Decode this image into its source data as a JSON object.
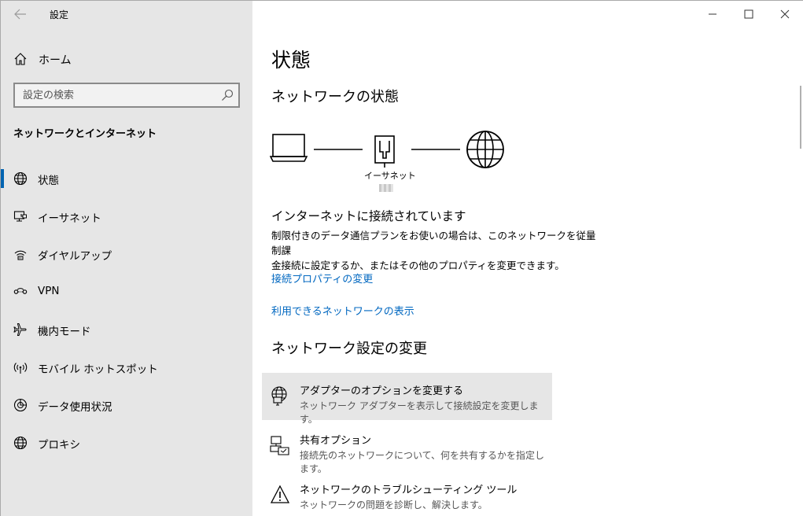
{
  "window": {
    "title": "設定"
  },
  "sidebar": {
    "home_label": "ホーム",
    "search_placeholder": "設定の検索",
    "section_label": "ネットワークとインターネット",
    "items": [
      {
        "label": "状態",
        "icon": "globe-icon",
        "active": true
      },
      {
        "label": "イーサネット",
        "icon": "ethernet-icon",
        "active": false
      },
      {
        "label": "ダイヤルアップ",
        "icon": "dialup-icon",
        "active": false
      },
      {
        "label": "VPN",
        "icon": "vpn-icon",
        "active": false
      },
      {
        "label": "機内モード",
        "icon": "airplane-icon",
        "active": false
      },
      {
        "label": "モバイル ホットスポット",
        "icon": "hotspot-icon",
        "active": false
      },
      {
        "label": "データ使用状況",
        "icon": "data-usage-icon",
        "active": false
      },
      {
        "label": "プロキシ",
        "icon": "globe-icon",
        "active": false
      }
    ]
  },
  "main": {
    "page_title": "状態",
    "network_status_title": "ネットワークの状態",
    "diagram_ethernet_label": "イーサネット",
    "connection_title": "インターネットに接続されています",
    "connection_desc_line1": "制限付きのデータ通信プランをお使いの場合は、このネットワークを従量制課",
    "connection_desc_line2": "金接続に設定するか、またはその他のプロパティを変更できます。",
    "link_properties": "接続プロパティの変更",
    "link_available": "利用できるネットワークの表示",
    "change_settings_title": "ネットワーク設定の変更",
    "options": [
      {
        "title": "アダプターのオプションを変更する",
        "desc": "ネットワーク アダプターを表示して接続設定を変更します。",
        "icon": "adapter-icon"
      },
      {
        "title": "共有オプション",
        "desc": "接続先のネットワークについて、何を共有するかを指定します。",
        "icon": "sharing-icon"
      },
      {
        "title": "ネットワークのトラブルシューティング ツール",
        "desc": "ネットワークの問題を診断し、解決します。",
        "icon": "warning-icon"
      }
    ]
  },
  "colors": {
    "sidebar_bg": "#e6e6e6",
    "accent": "#0063b1",
    "link": "#0067c0"
  }
}
